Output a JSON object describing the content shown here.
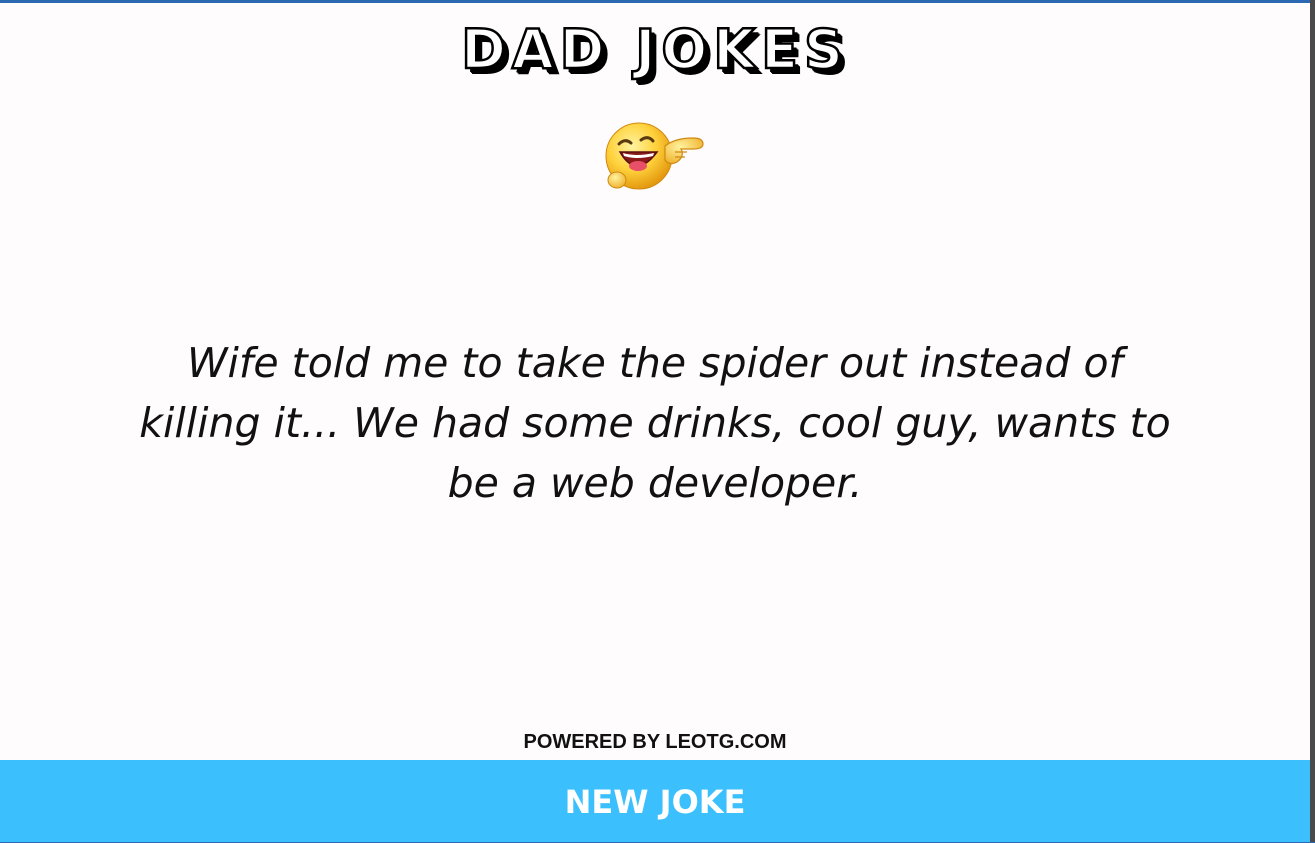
{
  "header": {
    "title": "DAD JOKES",
    "emoji_icon": "laughing-pointing-emoji-icon"
  },
  "joke": {
    "text": "Wife told me to take the spider out instead of killing it... We had some drinks, cool guy, wants to be a web developer."
  },
  "footer": {
    "powered_by": "POWERED BY LEOTG.COM",
    "new_joke_label": "NEW JOKE"
  },
  "colors": {
    "top_border": "#2d69b3",
    "background": "#fefcfd",
    "button_bg": "#3cc0fd",
    "button_text": "#ffffff"
  }
}
